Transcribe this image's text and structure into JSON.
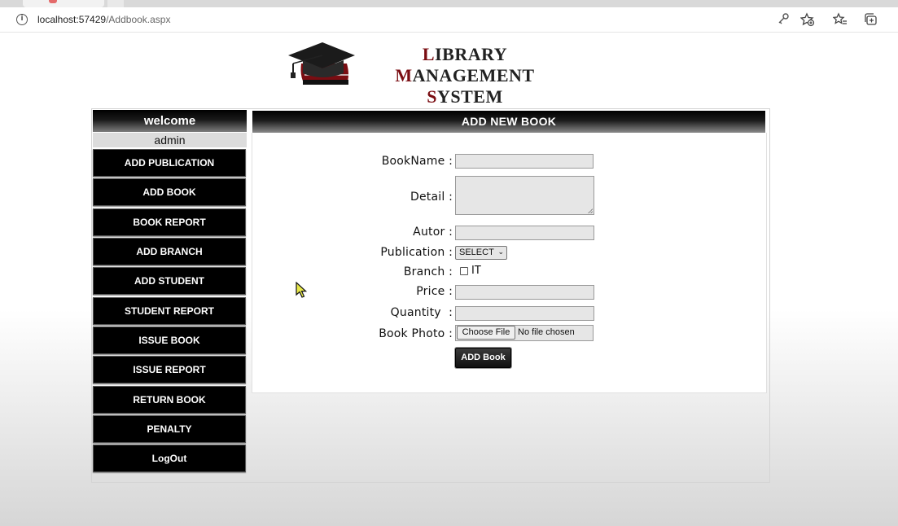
{
  "browser": {
    "url_host": "localhost:57429",
    "url_path": "/Addbook.aspx"
  },
  "header": {
    "title_line1_a": "L",
    "title_line1_b": "IBRARY ",
    "title_line1_c": "M",
    "title_line1_d": "ANAGEMENT",
    "title_line2_a": "S",
    "title_line2_b": "YSTEM"
  },
  "sidebar": {
    "welcome": "welcome",
    "username": "admin",
    "items": [
      {
        "label": "ADD PUBLICATION"
      },
      {
        "label": "ADD BOOK"
      },
      {
        "label": "BOOK REPORT"
      },
      {
        "label": "ADD BRANCH"
      },
      {
        "label": "ADD STUDENT"
      },
      {
        "label": "STUDENT REPORT"
      },
      {
        "label": "ISSUE BOOK"
      },
      {
        "label": "ISSUE REPORT"
      },
      {
        "label": "RETURN BOOK"
      },
      {
        "label": "PENALTY"
      },
      {
        "label": "LogOut"
      }
    ]
  },
  "form": {
    "heading": "ADD NEW BOOK",
    "labels": {
      "bookname": "BookName :",
      "detail": "Detail :",
      "autor": "Autor :",
      "publication": "Publication :",
      "branch": "Branch :",
      "price": "Price :",
      "quantity": "Quantity  :",
      "photo": "Book Photo :"
    },
    "publication_selected": "SELECT",
    "branch_option": "IT",
    "file_button": "Choose File",
    "file_status": "No file chosen",
    "submit": "ADD Book"
  }
}
